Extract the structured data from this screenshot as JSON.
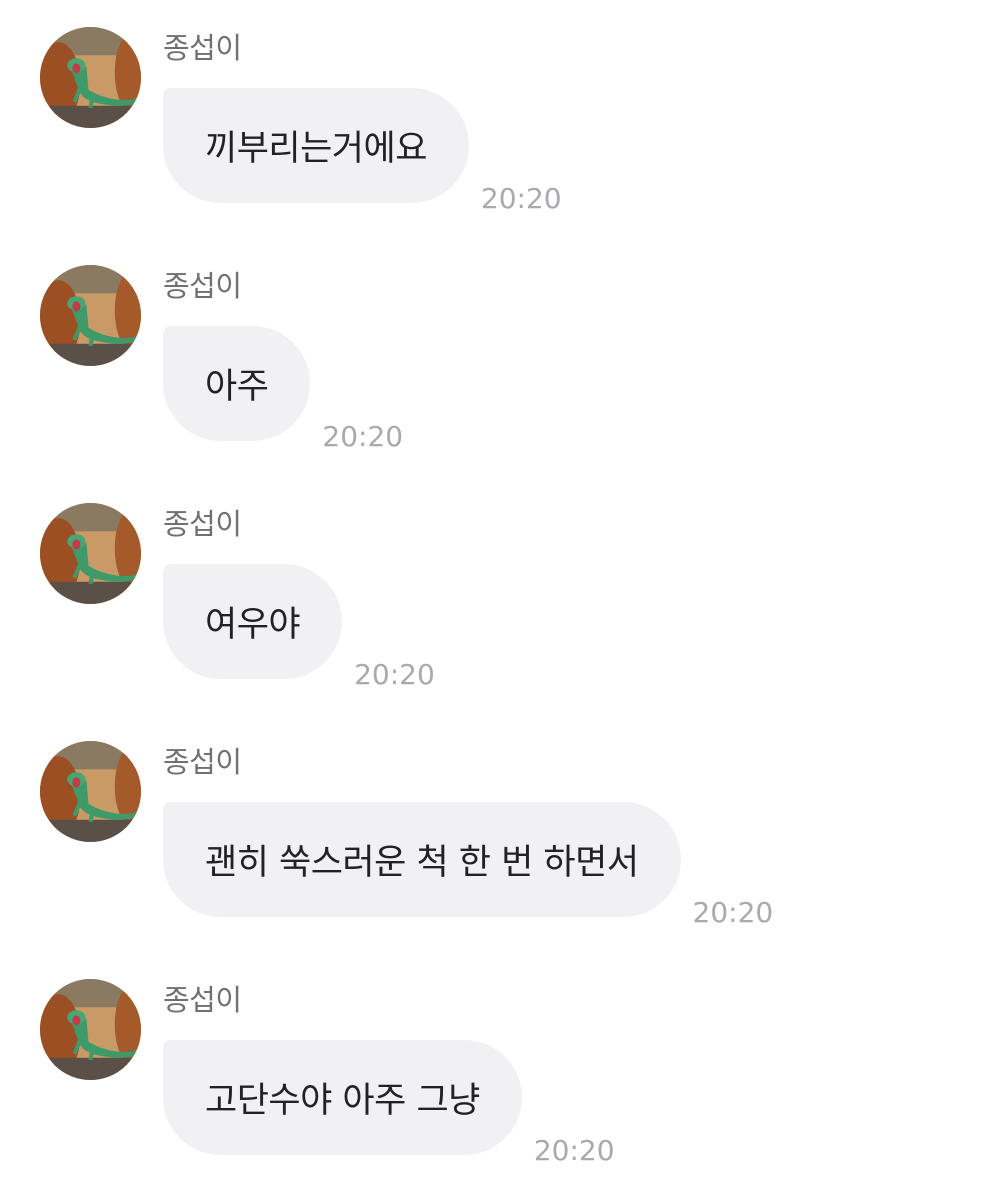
{
  "messages": [
    {
      "sender": "종섭이",
      "text": "끼부리는거에요",
      "time": "20:20"
    },
    {
      "sender": "종섭이",
      "text": "아주",
      "time": "20:20"
    },
    {
      "sender": "종섭이",
      "text": "여우야",
      "time": "20:20"
    },
    {
      "sender": "종섭이",
      "text": "괜히 쑥스러운 척 한 번 하면서",
      "time": "20:20"
    },
    {
      "sender": "종섭이",
      "text": "고단수야 아주 그냥",
      "time": "20:20"
    }
  ],
  "colors": {
    "bubble": "#f1f1f4",
    "sender": "#707074",
    "text": "#222226",
    "time": "#a9a9ae"
  },
  "icons": {
    "avatar": "avatar-lizard-photo"
  }
}
